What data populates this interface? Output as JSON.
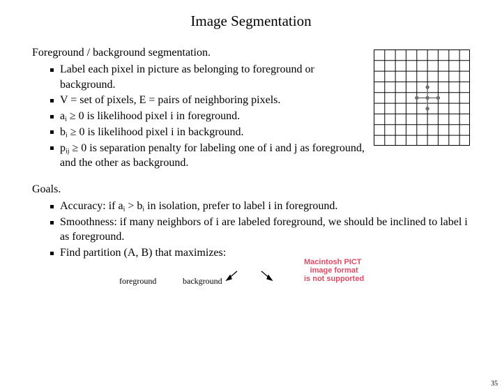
{
  "title": "Image Segmentation",
  "section1": {
    "head": "Foreground / background segmentation.",
    "b1": "Label each pixel in picture as belonging to foreground or background.",
    "b2": "V = set of pixels, E = pairs of neighboring pixels.",
    "b3a": "a",
    "b3b": "i",
    "b3c": " ≥ 0 is likelihood pixel i in foreground.",
    "b4a": "b",
    "b4b": "i",
    "b4c": " ≥ 0 is likelihood pixel i in background.",
    "b5a": "p",
    "b5b": "ij",
    "b5c": " ≥ 0 is separation penalty for labeling one of i and j as foreground, and the other as background."
  },
  "goals": {
    "head": "Goals.",
    "g1a": "Accuracy:  if a",
    "g1b": "i",
    "g1c": " > b",
    "g1d": "i",
    "g1e": " in isolation, prefer to label i in foreground.",
    "g2": "Smoothness: if many neighbors of i are labeled foreground, we should be inclined to label i as foreground.",
    "g3": "Find partition (A, B) that maximizes:"
  },
  "labels": {
    "fg": "foreground",
    "bg": "background"
  },
  "pict_lines": {
    "l1": "Macintosh PICT",
    "l2": "image format",
    "l3": "is not supported"
  },
  "page_number": "35"
}
